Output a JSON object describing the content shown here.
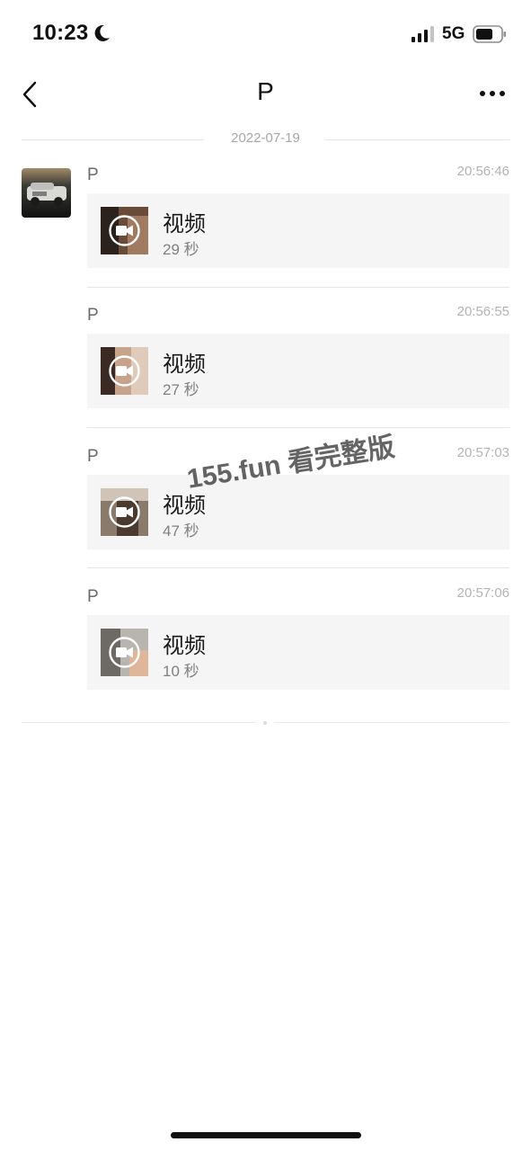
{
  "status_bar": {
    "time": "10:23",
    "network": "5G",
    "icons": [
      "moon-icon",
      "signal-icon",
      "battery-icon"
    ]
  },
  "nav": {
    "title": "P",
    "icons": [
      "back-icon",
      "more-icon"
    ]
  },
  "date_divider": "2022-07-19",
  "messages": [
    {
      "sender": "P",
      "time": "20:56:46",
      "title": "视频",
      "duration": "29 秒"
    },
    {
      "sender": "P",
      "time": "20:56:55",
      "title": "视频",
      "duration": "27 秒"
    },
    {
      "sender": "P",
      "time": "20:57:03",
      "title": "视频",
      "duration": "47 秒"
    },
    {
      "sender": "P",
      "time": "20:57:06",
      "title": "视频",
      "duration": "10 秒"
    }
  ],
  "watermark": "155.fun 看完整版"
}
